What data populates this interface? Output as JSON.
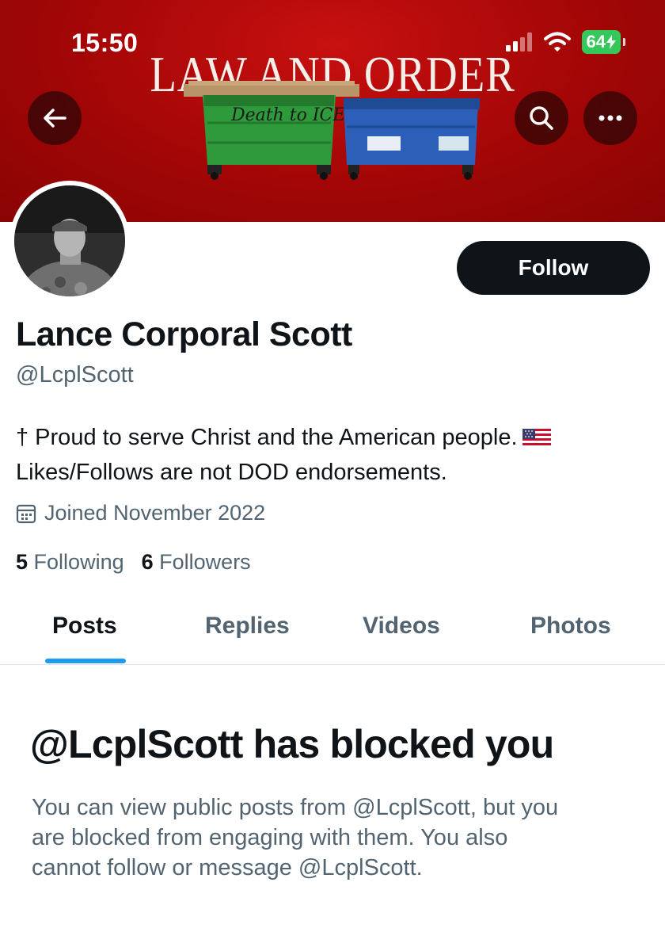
{
  "status_bar": {
    "time": "15:50",
    "battery": "64"
  },
  "banner": {
    "title": "LAW AND ORDER",
    "graffiti": "Death to ICE"
  },
  "nav": {
    "back_icon": "arrow-left-icon",
    "search_icon": "search-icon",
    "more_icon": "more-horizontal-icon"
  },
  "profile": {
    "display_name": "Lance Corporal Scott",
    "handle": "@LcplScott",
    "bio_line1": "† Proud to serve Christ and the American people.",
    "bio_line2": "Likes/Follows are not DOD endorsements.",
    "flag_icon": "us-flag-icon",
    "joined": "Joined November 2022",
    "following_count": "5",
    "following_label": "Following",
    "followers_count": "6",
    "followers_label": "Followers",
    "follow_button": "Follow"
  },
  "tabs": [
    {
      "label": "Posts",
      "active": true
    },
    {
      "label": "Replies",
      "active": false
    },
    {
      "label": "Videos",
      "active": false
    },
    {
      "label": "Photos",
      "active": false
    }
  ],
  "blocked": {
    "title": "@LcplScott has blocked you",
    "line1": "You can view public posts from @LcplScott, but you",
    "line2": "are blocked from engaging with them. You also",
    "line3": "cannot follow or message @LcplScott."
  },
  "colors": {
    "banner_red": "#a30606",
    "text_primary": "#0f1419",
    "text_secondary": "#536471",
    "accent_blue": "#1d9bf0",
    "battery_green": "#34c759"
  }
}
